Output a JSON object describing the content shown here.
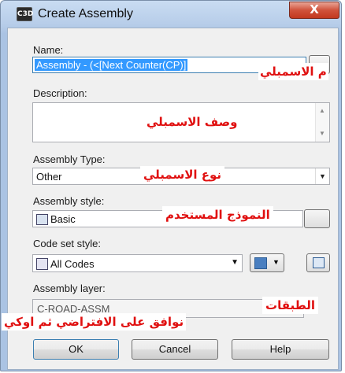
{
  "window": {
    "title": "Create Assembly",
    "close_label": "X",
    "app_icon_label": "C3D"
  },
  "name": {
    "label": "Name:",
    "value": "Assembly - (<[Next Counter(CP)]",
    "note": "م الاسمبلي"
  },
  "description": {
    "label": "Description:",
    "value": "",
    "note": "وصف الاسمبلي"
  },
  "assembly_type": {
    "label": "Assembly Type:",
    "value": "Other",
    "note": "نوع الاسمبلي"
  },
  "assembly_style": {
    "label": "Assembly style:",
    "value": "Basic",
    "note": "النموذج المستخدم"
  },
  "code_set_style": {
    "label": "Code set style:",
    "value": "All Codes"
  },
  "assembly_layer": {
    "label": "Assembly layer:",
    "value": "C-ROAD-ASSM",
    "note": "الطبقات"
  },
  "footer_note": "نوافق على الافتراضي ثم اوكي",
  "buttons": {
    "ok": "OK",
    "cancel": "Cancel",
    "help": "Help"
  },
  "icons": {
    "close": "close-icon",
    "dropdown": "chevron-down-icon",
    "edit": "edit-style-icon",
    "preview": "preview-icon"
  }
}
